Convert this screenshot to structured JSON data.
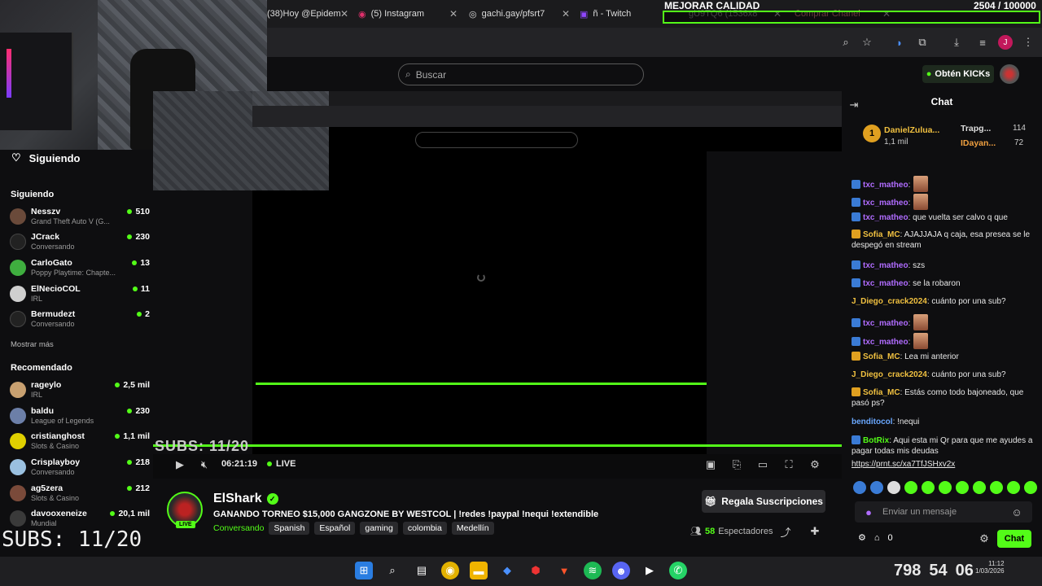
{
  "browser": {
    "tabs": [
      {
        "label": "(38)Hoy @Epidem"
      },
      {
        "label": "(5) Instagram"
      },
      {
        "label": "gachi.gay/pfsrt7"
      },
      {
        "label": "ñ - Twitch"
      },
      {
        "label": "gU9TQ6 (1536x8"
      },
      {
        "label": "Comprar Chanel"
      }
    ]
  },
  "stream_overlay": {
    "title": "MEJORAR CALIDAD",
    "count": "2504 / 100000",
    "subs_small": "SUBS: 11/20",
    "subs_big": "SUBS: 11/20"
  },
  "site": {
    "search_placeholder": "Buscar",
    "kicks_label": "Obtén KICKs"
  },
  "sidebar": {
    "following_header": "Siguiendo",
    "following_section": "Siguiendo",
    "following": [
      {
        "name": "Nesszv",
        "category": "Grand Theft Auto V (G...",
        "viewers": "510",
        "color": "#6a4a3a"
      },
      {
        "name": "JCrack",
        "category": "Conversando",
        "viewers": "230",
        "color": "#222"
      },
      {
        "name": "CarloGato",
        "category": "Poppy Playtime: Chapte...",
        "viewers": "13",
        "color": "#3fae3f"
      },
      {
        "name": "ElNecioCOL",
        "category": "IRL",
        "viewers": "11",
        "color": "#cfcfcf"
      },
      {
        "name": "Bermudezt",
        "category": "Conversando",
        "viewers": "2",
        "color": "#222"
      }
    ],
    "show_more_1": "Mostrar más",
    "recommended_section": "Recomendado",
    "recommended": [
      {
        "name": "rageylo",
        "category": "IRL",
        "viewers": "2,5 mil",
        "color": "#c8a070"
      },
      {
        "name": "baldu",
        "category": "League of Legends",
        "viewers": "230",
        "color": "#6c7fa8"
      },
      {
        "name": "cristianghost",
        "category": "Slots & Casino",
        "viewers": "1,1 mil",
        "color": "#e0d000"
      },
      {
        "name": "Crisplayboy",
        "category": "Conversando",
        "viewers": "218",
        "color": "#9ac0e0"
      },
      {
        "name": "ag5zera",
        "category": "Slots & Casino",
        "viewers": "212",
        "color": "#7a4a3a"
      },
      {
        "name": "davooxeneize",
        "category": "Mundial",
        "viewers": "20,1 mil",
        "color": "#3a3a3a"
      }
    ]
  },
  "player": {
    "time": "06:21:19",
    "live": "LIVE"
  },
  "streamer": {
    "name": "ElShark",
    "live_badge": "LIVE",
    "title": "GANANDO TORNEO $15,000 GANGZONE BY WESTCOL | !redes !paypal !nequi !extendible",
    "category": "Conversando",
    "tags": [
      "Spanish",
      "Español",
      "gaming",
      "colombia",
      "Medellín"
    ],
    "subs_button": "Regala Suscripciones",
    "viewers_count": "58",
    "viewers_label": "Espectadores"
  },
  "chat": {
    "title": "Chat",
    "pinned": [
      {
        "user": "DanielZulua...",
        "amount": "1,1 mil"
      },
      {
        "user": "Trapg...",
        "amount": "114"
      },
      {
        "user": "IDayan...",
        "amount": "72"
      }
    ],
    "messages": [
      {
        "user": "txc_matheo",
        "text": ":",
        "color": "#b06cff",
        "emote": true
      },
      {
        "user": "txc_matheo",
        "text": ":",
        "color": "#b06cff",
        "emote": true
      },
      {
        "user": "txc_matheo",
        "text": ": que vuelta ser calvo q que",
        "color": "#b06cff",
        "emote": false
      },
      {
        "user": "Sofia_MC",
        "text": ": AJAJJAJA q caja, esa presea se le despegó en stream",
        "color": "#f0c040",
        "emote": false
      },
      {
        "user": "txc_matheo",
        "text": ": szs",
        "color": "#b06cff",
        "emote": false
      },
      {
        "user": "txc_matheo",
        "text": ": se la robaron",
        "color": "#b06cff",
        "emote": false
      },
      {
        "user": "J_Diego_crack2024",
        "text": ": cuánto por una sub?",
        "color": "#f0c040",
        "emote": false
      },
      {
        "user": "txc_matheo",
        "text": ":",
        "color": "#b06cff",
        "emote": true
      },
      {
        "user": "txc_matheo",
        "text": ":",
        "color": "#b06cff",
        "emote": true
      },
      {
        "user": "Sofia_MC",
        "text": ": Lea mi anterior",
        "color": "#f0c040",
        "emote": false
      },
      {
        "user": "J_Diego_crack2024",
        "text": ": cuánto por una sub?",
        "color": "#f0c040",
        "emote": false
      },
      {
        "user": "Sofia_MC",
        "text": ": Estás como todo bajoneado, que pasó ps?",
        "color": "#f0c040",
        "emote": false
      },
      {
        "user": "benditocol",
        "text": ": !nequi",
        "color": "#6aa8ff",
        "emote": false
      },
      {
        "user": "BotRix",
        "text": ": Aqui esta mi Qr para que me ayudes a pagar todas mis deudas",
        "color": "#53fc18",
        "emote": false
      },
      {
        "user": "",
        "text": "https://prnt.sc/xa7TfJSHxv2x",
        "color": "#ffffff",
        "emote": false
      }
    ],
    "input_placeholder": "Enviar un mensaje",
    "send_button": "Chat",
    "kicks_count": "0"
  },
  "taskbar": {
    "tray_numbers": [
      "798",
      "54",
      "06"
    ],
    "time": "11:12",
    "date": "1/03/2026"
  }
}
